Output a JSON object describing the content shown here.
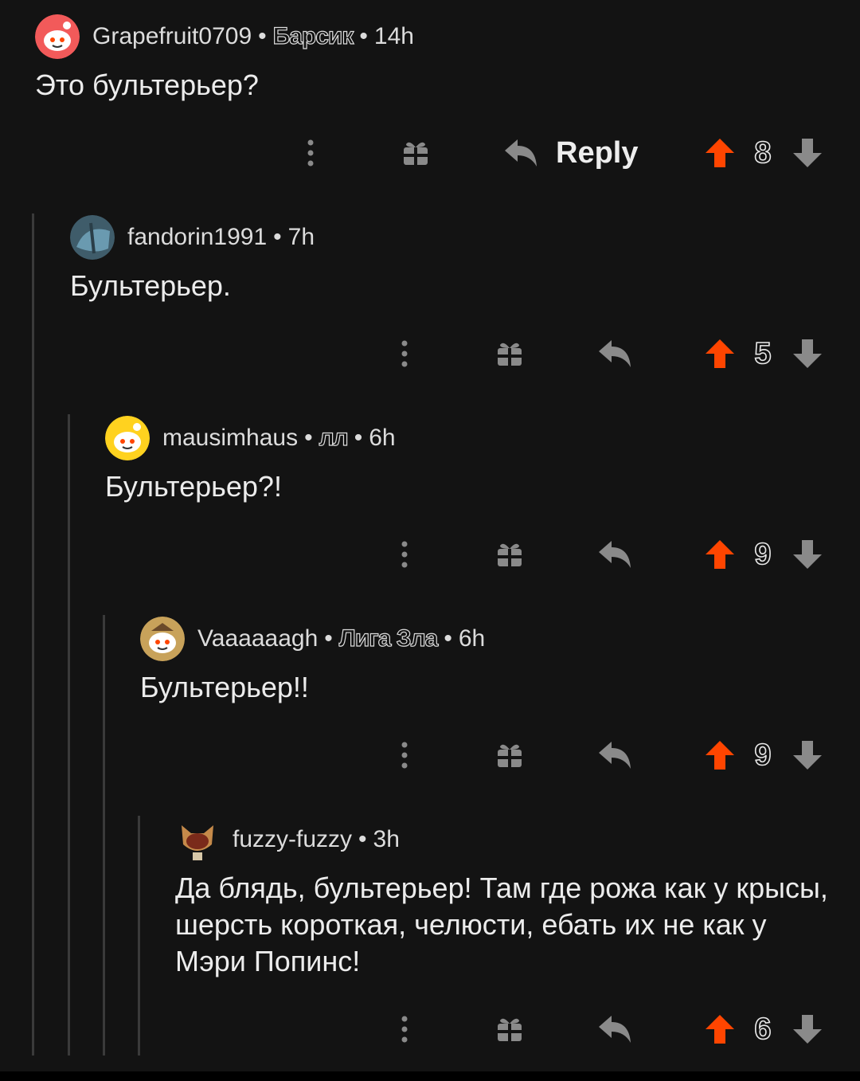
{
  "comments": [
    {
      "username": "Grapefruit0709",
      "flair": "Барсик",
      "time": "14h",
      "text": "Это бультерьер?",
      "score": "8",
      "reply_label": "Reply",
      "avatar_color": "#f25a5a"
    },
    {
      "username": "fandorin1991",
      "flair": "",
      "time": "7h",
      "text": "Бультерьер.",
      "score": "5",
      "reply_label": "",
      "avatar_color": "#4a6a78"
    },
    {
      "username": "mausimhaus",
      "flair": "лл",
      "time": "6h",
      "text": "Бультерьер?!",
      "score": "9",
      "reply_label": "",
      "avatar_color": "#ffd21f"
    },
    {
      "username": "Vaaaaaagh",
      "flair": "Лига Зла",
      "time": "6h",
      "text": "Бультерьер!!",
      "score": "9",
      "reply_label": "",
      "avatar_color": "#c8a25a"
    },
    {
      "username": "fuzzy-fuzzy",
      "flair": "",
      "time": "3h",
      "text": "Да блядь, бультерьер! Там где рожа как у крысы, шерсть короткая, челюсти, ебать их не как у Мэри Попинс!",
      "score": "6",
      "reply_label": "",
      "avatar_color": "#c58a4a"
    }
  ],
  "colors": {
    "upvote": "#ff4500",
    "background": "#131313",
    "icon": "#8a8a8a"
  },
  "icons": [
    "more-icon",
    "award-icon",
    "reply-icon",
    "upvote-icon",
    "downvote-icon"
  ]
}
